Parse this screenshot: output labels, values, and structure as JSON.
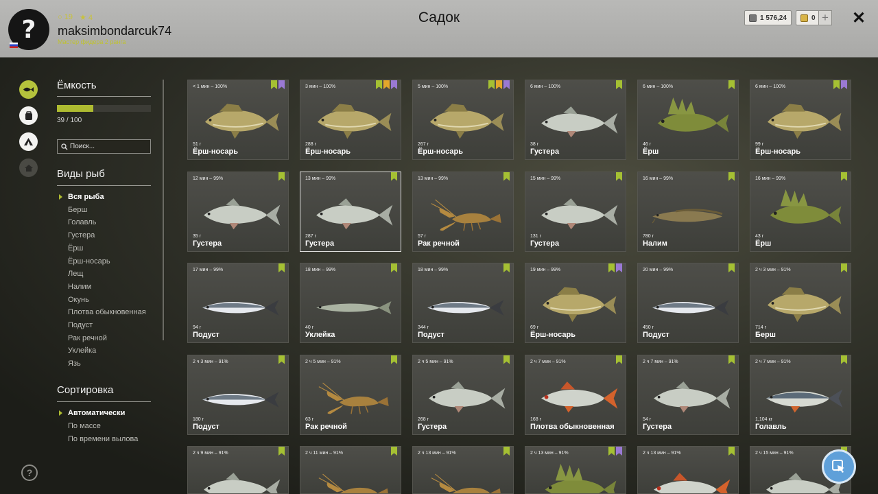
{
  "header": {
    "title": "Садок",
    "username": "maksimbondarcuk74",
    "rank": "Мастер фидера 2 ранга",
    "level_a": "19",
    "level_b": "4",
    "avatar_glyph": "?",
    "silver": "1 576,24",
    "gold": "0",
    "add_label": "+",
    "close_label": "✕"
  },
  "capacity": {
    "title": "Ёмкость",
    "count": "39 / 100",
    "fill_fraction": 0.39
  },
  "search": {
    "placeholder": "Поиск..."
  },
  "species": {
    "title": "Виды рыб",
    "items": [
      "Вся рыба",
      "Берш",
      "Голавль",
      "Густера",
      "Ёрш",
      "Ёрш-носарь",
      "Лещ",
      "Налим",
      "Окунь",
      "Плотва обыкновенная",
      "Подуст",
      "Рак речной",
      "Уклейка",
      "Язь"
    ],
    "selected": 0
  },
  "sorting": {
    "title": "Сортировка",
    "items": [
      "Автоматически",
      "По массе",
      "По времени вылова"
    ],
    "selected": 0
  },
  "help_glyph": "?",
  "colors": {
    "accent": "#aebb31",
    "badge_green": "#a5c033",
    "badge_orange": "#e3a72b",
    "badge_purple": "#9a79d4"
  },
  "fish_cards": [
    {
      "time": "< 1 мин – 100%",
      "weight": "51 г",
      "name": "Ёрш-носарь",
      "shape": "zander",
      "badges": [
        "g",
        "p"
      ]
    },
    {
      "time": "3 мин – 100%",
      "weight": "288 г",
      "name": "Ёрш-носарь",
      "shape": "zander",
      "badges": [
        "g",
        "o",
        "p"
      ]
    },
    {
      "time": "5 мин – 100%",
      "weight": "267 г",
      "name": "Ёрш-носарь",
      "shape": "zander",
      "badges": [
        "g",
        "o",
        "p"
      ]
    },
    {
      "time": "6 мин – 100%",
      "weight": "38 г",
      "name": "Густера",
      "shape": "bream",
      "badges": [
        "g"
      ]
    },
    {
      "time": "6 мин – 100%",
      "weight": "46 г",
      "name": "Ёрш",
      "shape": "ruffe",
      "badges": [
        "g"
      ]
    },
    {
      "time": "6 мин – 100%",
      "weight": "99 г",
      "name": "Ёрш-носарь",
      "shape": "zander",
      "badges": [
        "g",
        "p"
      ]
    },
    {
      "time": "12 мин – 99%",
      "weight": "35 г",
      "name": "Густера",
      "shape": "bream",
      "badges": [
        "g"
      ]
    },
    {
      "time": "13 мин – 99%",
      "weight": "287 г",
      "name": "Густера",
      "shape": "bream",
      "badges": [
        "g"
      ],
      "selected": true
    },
    {
      "time": "13 мин – 99%",
      "weight": "57 г",
      "name": "Рак речной",
      "shape": "crayfish",
      "badges": [
        "g"
      ]
    },
    {
      "time": "15 мин – 99%",
      "weight": "131 г",
      "name": "Густера",
      "shape": "bream",
      "badges": [
        "g"
      ]
    },
    {
      "time": "16 мин – 99%",
      "weight": "780 г",
      "name": "Налим",
      "shape": "burbot",
      "badges": [
        "g"
      ]
    },
    {
      "time": "16 мин – 99%",
      "weight": "43 г",
      "name": "Ёрш",
      "shape": "ruffe",
      "badges": [
        "g"
      ]
    },
    {
      "time": "17 мин – 99%",
      "weight": "94 г",
      "name": "Подуст",
      "shape": "slim",
      "badges": [
        "g"
      ]
    },
    {
      "time": "18 мин – 99%",
      "weight": "40 г",
      "name": "Уклейка",
      "shape": "bleak",
      "badges": [
        "g"
      ]
    },
    {
      "time": "18 мин – 99%",
      "weight": "344 г",
      "name": "Подуст",
      "shape": "slim",
      "badges": [
        "g"
      ]
    },
    {
      "time": "19 мин – 99%",
      "weight": "69 г",
      "name": "Ёрш-носарь",
      "shape": "zander",
      "badges": [
        "g",
        "p"
      ]
    },
    {
      "time": "20 мин – 99%",
      "weight": "450 г",
      "name": "Подуст",
      "shape": "slim",
      "badges": [
        "g"
      ]
    },
    {
      "time": "2 ч 3 мин – 91%",
      "weight": "714 г",
      "name": "Берш",
      "shape": "zander",
      "badges": [
        "g"
      ]
    },
    {
      "time": "2 ч 3 мин – 91%",
      "weight": "180 г",
      "name": "Подуст",
      "shape": "slim",
      "badges": [
        "g"
      ]
    },
    {
      "time": "2 ч 5 мин – 91%",
      "weight": "63 г",
      "name": "Рак речной",
      "shape": "crayfish",
      "badges": [
        "g"
      ]
    },
    {
      "time": "2 ч 5 мин – 91%",
      "weight": "268 г",
      "name": "Густера",
      "shape": "bream",
      "badges": [
        "g"
      ]
    },
    {
      "time": "2 ч 7 мин – 91%",
      "weight": "168 г",
      "name": "Плотва обыкновенная",
      "shape": "roach",
      "badges": [
        "g"
      ]
    },
    {
      "time": "2 ч 7 мин – 91%",
      "weight": "54 г",
      "name": "Густера",
      "shape": "bream",
      "badges": [
        "g"
      ]
    },
    {
      "time": "2 ч 7 мин – 91%",
      "weight": "1,104 кг",
      "name": "Голавль",
      "shape": "chub",
      "badges": [
        "g"
      ]
    },
    {
      "time": "2 ч 9 мин – 91%",
      "weight": "",
      "name": "",
      "shape": "bream",
      "badges": [
        "g"
      ]
    },
    {
      "time": "2 ч 11 мин – 91%",
      "weight": "",
      "name": "",
      "shape": "crayfish",
      "badges": [
        "g"
      ]
    },
    {
      "time": "2 ч 13 мин – 91%",
      "weight": "",
      "name": "",
      "shape": "crayfish",
      "badges": [
        "g"
      ]
    },
    {
      "time": "2 ч 13 мин – 91%",
      "weight": "",
      "name": "",
      "shape": "ruffe",
      "badges": [
        "g",
        "p"
      ]
    },
    {
      "time": "2 ч 13 мин – 91%",
      "weight": "",
      "name": "",
      "shape": "roach",
      "badges": [
        "g"
      ]
    },
    {
      "time": "2 ч 15 мин – 91%",
      "weight": "",
      "name": "",
      "shape": "bream",
      "badges": [
        "g"
      ]
    }
  ]
}
